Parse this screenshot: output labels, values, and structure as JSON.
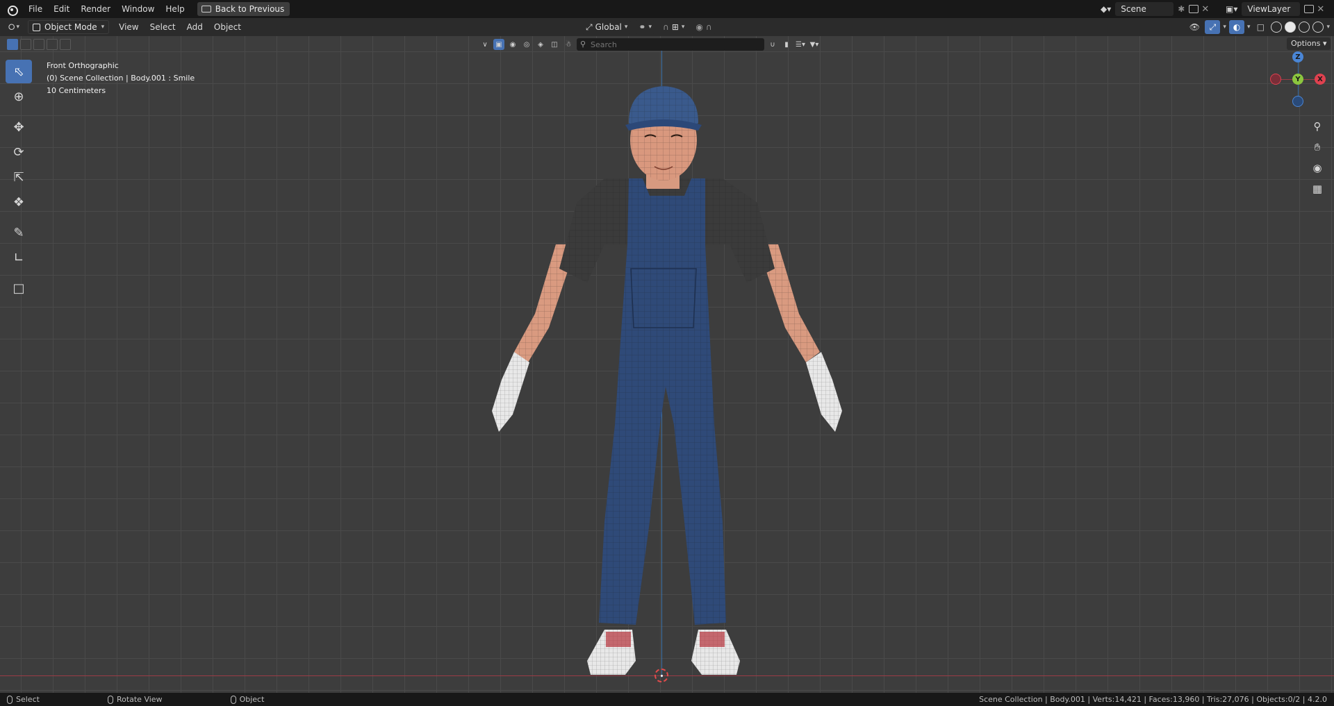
{
  "topbar": {
    "menus": [
      "File",
      "Edit",
      "Render",
      "Window",
      "Help"
    ],
    "back_button": "Back to Previous",
    "scene": "Scene",
    "view_layer": "ViewLayer"
  },
  "header": {
    "mode": "Object Mode",
    "menus": [
      "View",
      "Select",
      "Add",
      "Object"
    ],
    "transform_orientation": "Global"
  },
  "viewport": {
    "view_name": "Front Orthographic",
    "collection_info": "(0) Scene Collection | Body.001 : Smile",
    "scale": "10 Centimeters",
    "search_placeholder": "Search",
    "options_label": "Options",
    "gizmo": {
      "z": "Z",
      "y": "Y",
      "x": "X"
    }
  },
  "statusbar": {
    "select": "Select",
    "rotate": "Rotate View",
    "object": "Object",
    "stats": "Scene Collection | Body.001 | Verts:14,421 | Faces:13,960 | Tris:27,076 | Objects:0/2 | 4.2.0"
  },
  "colors": {
    "accent": "#4772b3",
    "overalls": "#2f4a78",
    "skin": "#d7957a",
    "shirt": "#3a3a3a",
    "glove": "#e6e6e6",
    "axis_x": "#9c3b46",
    "axis_z": "#3a6fa8"
  }
}
